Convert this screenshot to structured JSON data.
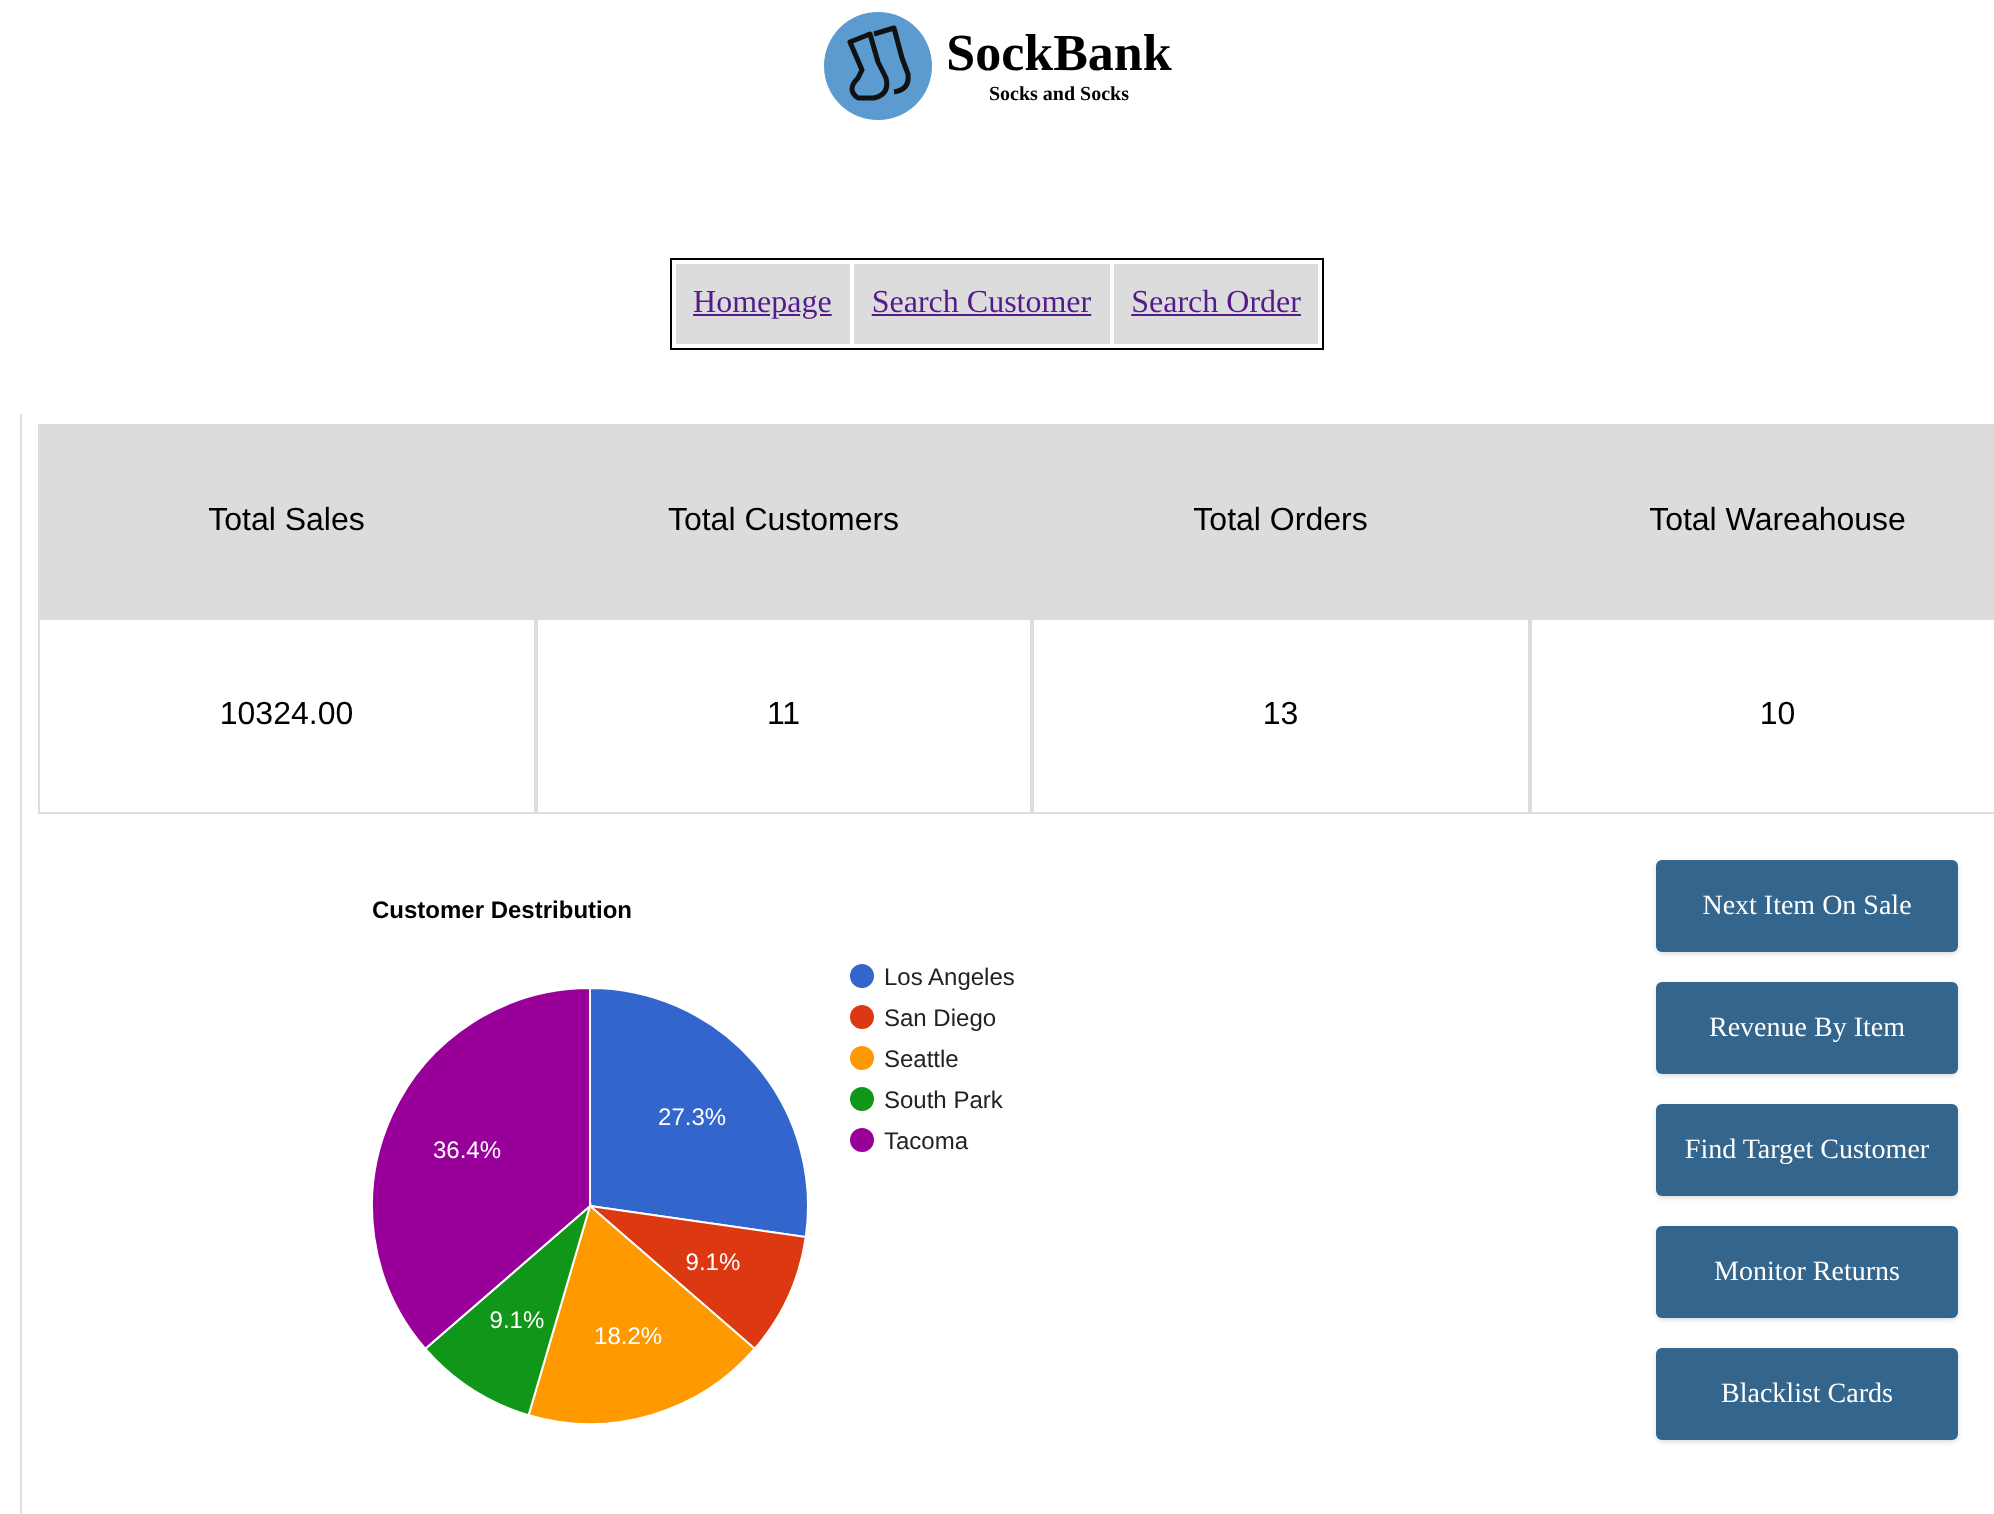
{
  "logo": {
    "name": "SockBank",
    "tagline": "Socks and Socks"
  },
  "nav": [
    {
      "label": "Homepage"
    },
    {
      "label": "Search Customer"
    },
    {
      "label": "Search Order"
    }
  ],
  "stats": {
    "columns": [
      "Total Sales",
      "Total Customers",
      "Total Orders",
      "Total Wareahouse"
    ],
    "values": [
      "10324.00",
      "11",
      "13",
      "10"
    ]
  },
  "chart_data": {
    "type": "pie",
    "title": "Customer Destribution",
    "categories": [
      "Los Angeles",
      "San Diego",
      "Seattle",
      "South Park",
      "Tacoma"
    ],
    "values": [
      27.3,
      9.1,
      18.2,
      9.1,
      36.4
    ],
    "legend": "right",
    "colors": [
      "#3366cc",
      "#dc3912",
      "#ff9900",
      "#109618",
      "#990099"
    ],
    "value_labels": [
      "27.3%",
      "9.1%",
      "18.2%",
      "9.1%",
      "36.4%"
    ]
  },
  "actions": [
    {
      "label": "Next Item On Sale"
    },
    {
      "label": "Revenue By Item"
    },
    {
      "label": "Find Target Customer"
    },
    {
      "label": "Monitor Returns"
    },
    {
      "label": "Blacklist Cards"
    }
  ]
}
